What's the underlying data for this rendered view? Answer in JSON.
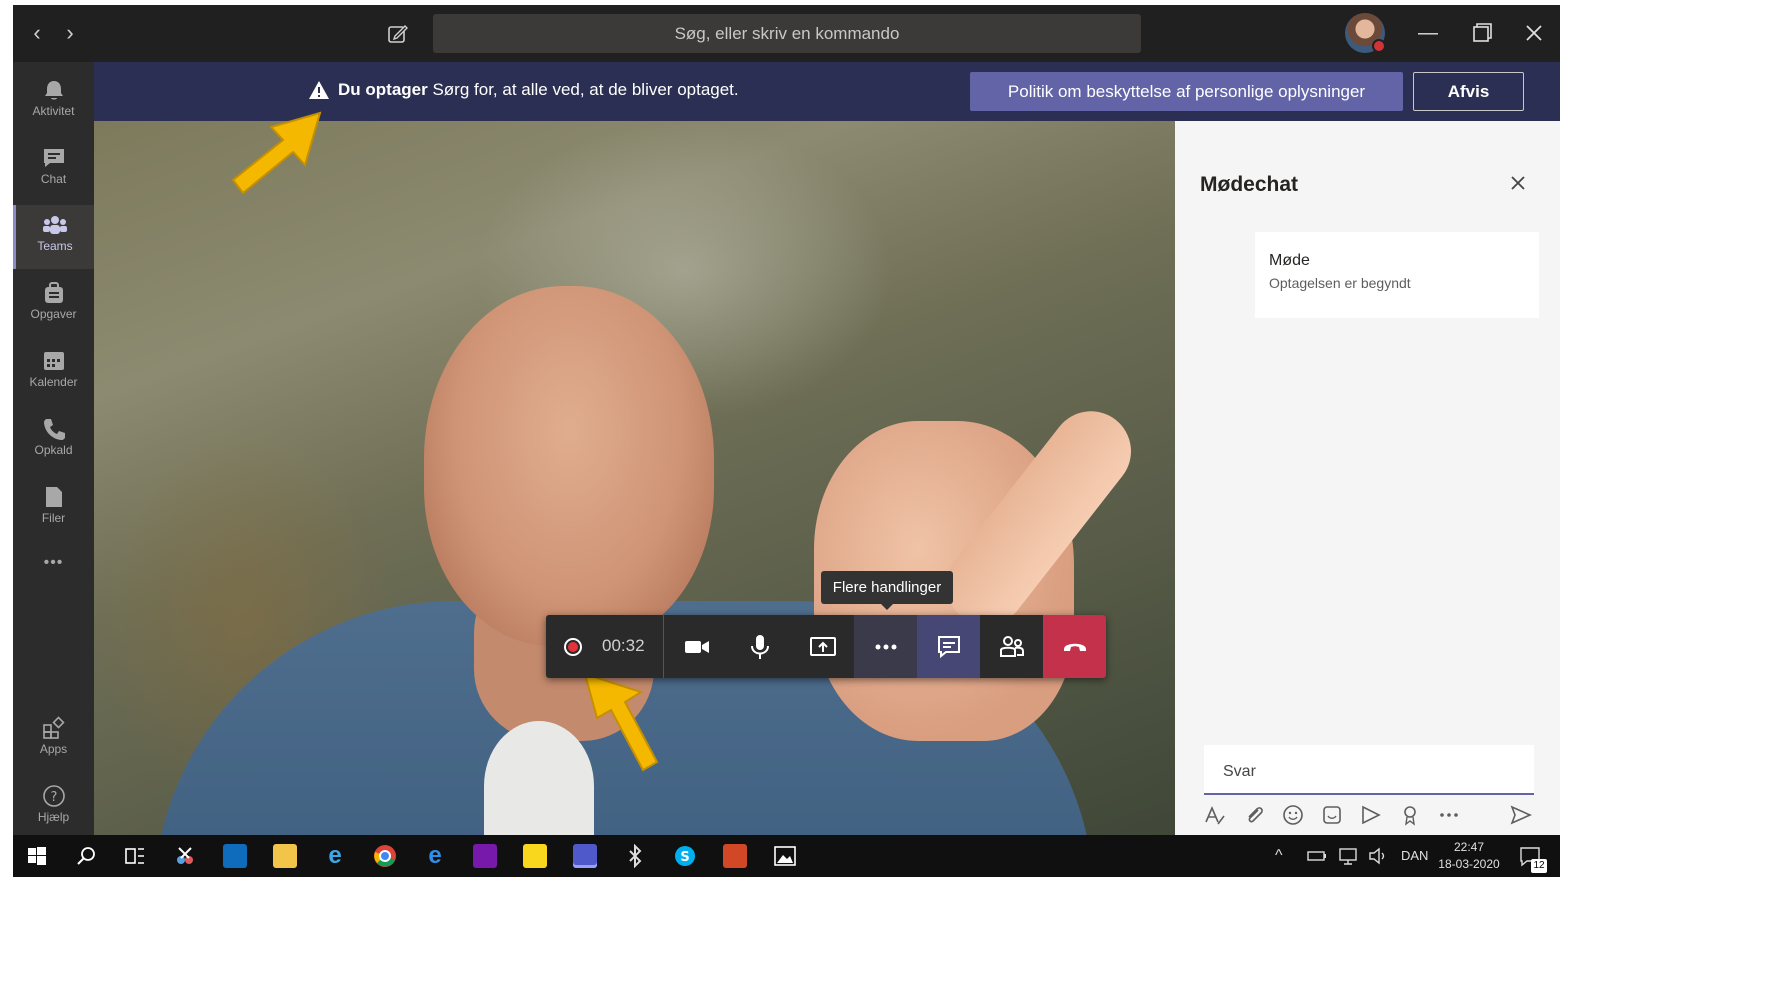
{
  "titlebar": {
    "search_placeholder": "Søg, eller skriv en kommando",
    "back_glyph": "‹",
    "forward_glyph": "›"
  },
  "rail": {
    "items": [
      {
        "label": "Aktivitet",
        "icon": "bell-icon"
      },
      {
        "label": "Chat",
        "icon": "chat-icon"
      },
      {
        "label": "Teams",
        "icon": "teams-icon",
        "active": true
      },
      {
        "label": "Opgaver",
        "icon": "briefcase-icon"
      },
      {
        "label": "Kalender",
        "icon": "calendar-icon"
      },
      {
        "label": "Opkald",
        "icon": "phone-icon"
      },
      {
        "label": "Filer",
        "icon": "file-icon"
      }
    ],
    "more_glyph": "•••",
    "apps_label": "Apps",
    "help_label": "Hjælp"
  },
  "banner": {
    "bold_text": "Du optager",
    "text": " Sørg for, at alle ved, at de bliver optaget.",
    "privacy_button": "Politik om beskyttelse af personlige oplysninger",
    "dismiss_button": "Afvis"
  },
  "callbar": {
    "recording_time": "00:32",
    "tooltip": "Flere handlinger"
  },
  "chat": {
    "title": "Mødechat",
    "message_title": "Møde",
    "message_sub": "Optagelsen er begyndt",
    "reply_placeholder": "Svar"
  },
  "taskbar": {
    "language": "DAN",
    "time": "22:47",
    "date": "18-03-2020",
    "notification_count": "12"
  },
  "colors": {
    "accent": "#6264a7",
    "banner": "#2b2f54",
    "hangup": "#c4314b",
    "arrow": "#f5b800"
  }
}
